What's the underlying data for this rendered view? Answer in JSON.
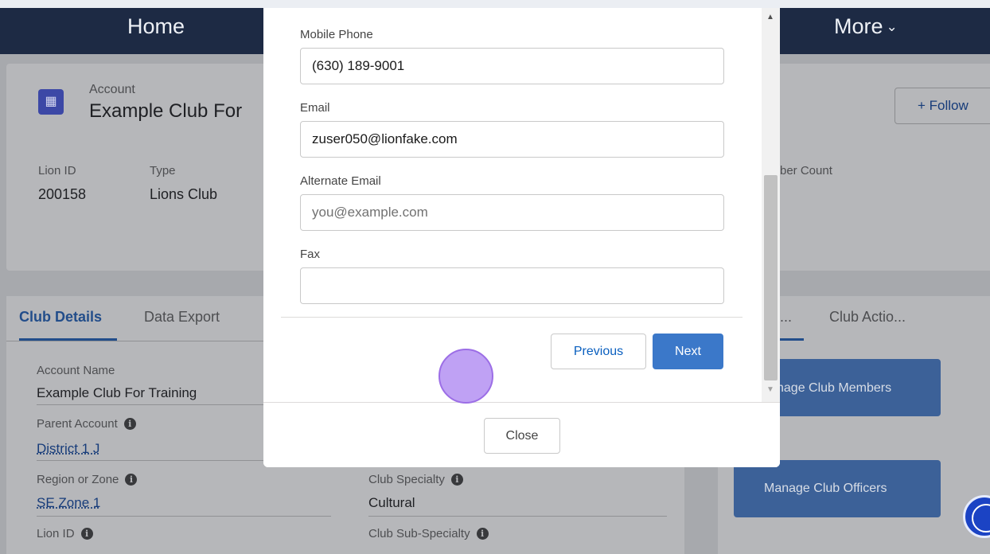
{
  "nav": {
    "home": "Home",
    "more": "More",
    "more_chevron": "⌄"
  },
  "account": {
    "icon_glyph": "▦",
    "label": "Account",
    "name": "Example Club For ",
    "follow_label": "+ Follow"
  },
  "highlights": {
    "lion_id_label": "Lion ID",
    "lion_id_value": "200158",
    "type_label": "Type",
    "type_value": "Lions Club",
    "member_count_label": "ber Count"
  },
  "tabs": {
    "club_details": "Club Details",
    "data_export": "Data Export"
  },
  "details": {
    "account_name_label": "Account Name",
    "account_name_value": "Example Club For Training",
    "parent_account_label": "Parent Account",
    "parent_account_value": "District 1 J",
    "region_label": "Region or Zone",
    "region_value": "SE Zone 1",
    "lion_id_label": "Lion ID",
    "club_specialty_label": "Club Specialty",
    "club_specialty_value": "Cultural",
    "club_sub_specialty_label": "Club Sub-Specialty",
    "info_glyph": "i"
  },
  "side": {
    "tab_partial": "...",
    "tab_club_actions": "Club Actio...",
    "manage_members": "nage Club Members",
    "manage_officers": "Manage Club Officers"
  },
  "modal": {
    "mobile_label": "Mobile Phone",
    "mobile_value": "(630) 189-9001",
    "email_label": "Email",
    "email_value": "zuser050@lionfake.com",
    "alt_email_label": "Alternate Email",
    "alt_email_placeholder": "you@example.com",
    "fax_label": "Fax",
    "fax_value": "",
    "previous": "Previous",
    "next": "Next",
    "close": "Close",
    "scroll_up": "▲",
    "scroll_down": "▼"
  },
  "colors": {
    "nav_bg": "#1d2a44",
    "brand_blue": "#3b78c9",
    "overlay_gray": "#a7a9ad",
    "click_indicator": "#b48cf0"
  },
  "icons": [
    "account-icon",
    "info-icon",
    "accessibility-icon",
    "chevron-down-icon",
    "scroll-up-arrow-icon",
    "scroll-down-arrow-icon"
  ]
}
